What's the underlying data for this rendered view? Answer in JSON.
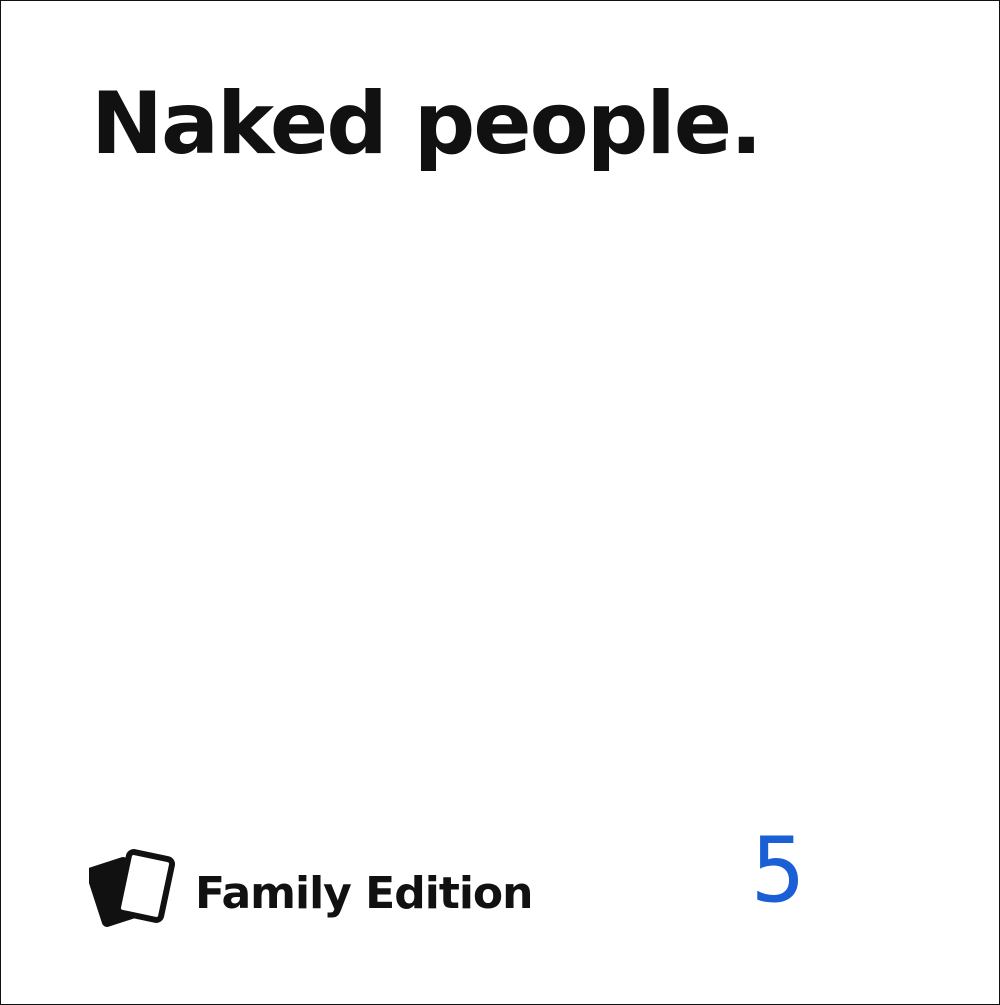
{
  "card": {
    "text": "Naked people.",
    "brand": {
      "logo_icon": "stacked-cards-icon",
      "name": "Family Edition"
    },
    "number": "5"
  },
  "colors": {
    "text": "#111111",
    "background": "#ffffff",
    "number": "#1a5fd6"
  }
}
